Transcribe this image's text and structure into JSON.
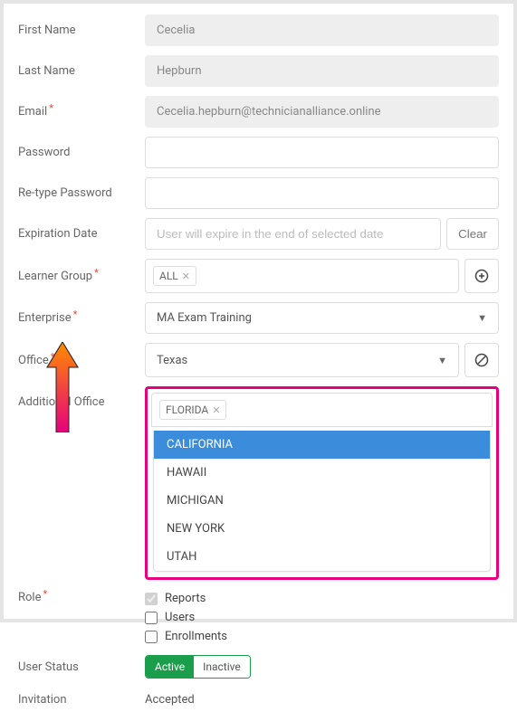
{
  "labels": {
    "first_name": "First Name",
    "last_name": "Last Name",
    "email": "Email",
    "password": "Password",
    "retype_password": "Re-type Password",
    "expiration_date": "Expiration Date",
    "learner_group": "Learner Group",
    "enterprise": "Enterprise",
    "office": "Office",
    "additional_office": "Additional Office",
    "role": "Role",
    "user_status": "User Status",
    "invitation": "Invitation"
  },
  "values": {
    "first_name": "Cecelia",
    "last_name": "Hepburn",
    "email": "Cecelia.hepburn@technicianalliance.online",
    "expiration_placeholder": "User will expire in the end of selected date",
    "clear": "Clear",
    "learner_group_tag": "ALL",
    "enterprise": "MA Exam Training",
    "office": "Texas",
    "additional_office_tag": "FLORIDA",
    "invitation": "Accepted"
  },
  "dropdown_options": [
    "CALIFORNIA",
    "HAWAII",
    "MICHIGAN",
    "NEW YORK",
    "UTAH"
  ],
  "checkboxes": {
    "reports": "Reports",
    "users": "Users",
    "enrollments": "Enrollments"
  },
  "status": {
    "active": "Active",
    "inactive": "Inactive"
  }
}
